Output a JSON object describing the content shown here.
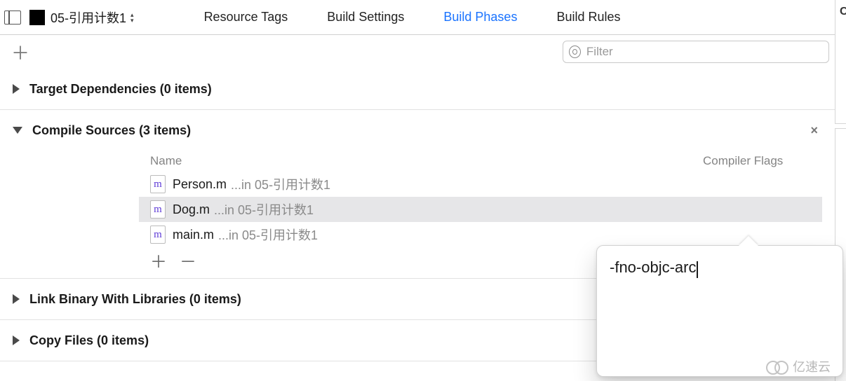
{
  "target": {
    "name": "05-引用计数1"
  },
  "tabs": {
    "resource_tags": "Resource Tags",
    "build_settings": "Build Settings",
    "build_phases": "Build Phases",
    "build_rules": "Build Rules"
  },
  "filter": {
    "placeholder": "Filter"
  },
  "sections": {
    "target_dependencies": {
      "title_prefix": "Target Dependencies",
      "count_text": "(0 items)"
    },
    "compile_sources": {
      "title_prefix": "Compile Sources",
      "count_text": "(3 items)",
      "columns": {
        "name": "Name",
        "flags": "Compiler Flags"
      },
      "files": [
        {
          "name": "Person.m",
          "path": "...in 05-引用计数1",
          "selected": false
        },
        {
          "name": "Dog.m",
          "path": "...in 05-引用计数1",
          "selected": true
        },
        {
          "name": "main.m",
          "path": "...in 05-引用计数1",
          "selected": false
        }
      ]
    },
    "link_binary": {
      "title_prefix": "Link Binary With Libraries",
      "count_text": "(0 items)"
    },
    "copy_files": {
      "title_prefix": "Copy Files",
      "count_text": "(0 items)"
    }
  },
  "popover": {
    "value": "-fno-objc-arc"
  },
  "watermark": {
    "text": "亿速云"
  },
  "glyphs": {
    "plus": "＋",
    "minus": "－",
    "close": "×"
  }
}
